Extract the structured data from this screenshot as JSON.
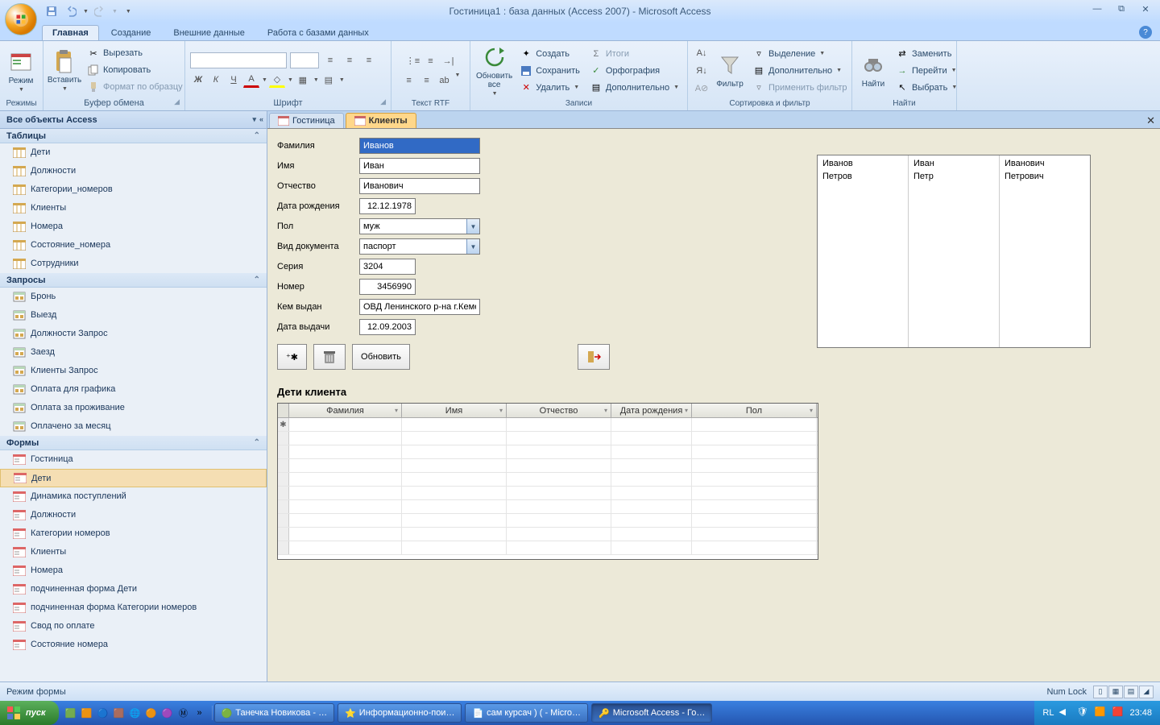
{
  "titlebar": {
    "title": "Гостиница1 : база данных (Access 2007) - Microsoft Access"
  },
  "tabs": {
    "main": "Главная",
    "create": "Создание",
    "extdata": "Внешние данные",
    "dbtools": "Работа с базами данных"
  },
  "ribbon": {
    "views": {
      "label": "Режимы",
      "view": "Режим"
    },
    "clipboard": {
      "label": "Буфер обмена",
      "paste": "Вставить",
      "cut": "Вырезать",
      "copy": "Копировать",
      "fmt": "Формат по образцу"
    },
    "font": {
      "label": "Шрифт"
    },
    "rtf": {
      "label": "Текст RTF"
    },
    "records": {
      "label": "Записи",
      "refresh": "Обновить\nвсе",
      "new": "Создать",
      "save": "Сохранить",
      "delete": "Удалить",
      "totals": "Итоги",
      "spelling": "Орфография",
      "more": "Дополнительно"
    },
    "sortfilter": {
      "label": "Сортировка и фильтр",
      "filter": "Фильтр",
      "selection": "Выделение",
      "advanced": "Дополнительно",
      "toggle": "Применить фильтр"
    },
    "find": {
      "label": "Найти",
      "find": "Найти",
      "replace": "Заменить",
      "goto": "Перейти",
      "select": "Выбрать"
    }
  },
  "nav": {
    "header": "Все объекты Access",
    "cat_tables": "Таблицы",
    "tables": [
      "Дети",
      "Должности",
      "Категории_номеров",
      "Клиенты",
      "Номера",
      "Состояние_номера",
      "Сотрудники"
    ],
    "cat_queries": "Запросы",
    "queries": [
      "Бронь",
      "Выезд",
      "Должности Запрос",
      "Заезд",
      "Клиенты Запрос",
      "Оплата для графика",
      "Оплата за проживание",
      "Оплачено за месяц"
    ],
    "cat_forms": "Формы",
    "forms": [
      "Гостиница",
      "Дети",
      "Динамика поступлений",
      "Должности",
      "Категории номеров",
      "Клиенты",
      "Номера",
      "подчиненная форма Дети",
      "подчиненная форма Категории номеров",
      "Свод по оплате",
      "Состояние номера"
    ]
  },
  "formtabs": {
    "t1": "Гостиница",
    "t2": "Клиенты"
  },
  "form": {
    "labels": {
      "surname": "Фамилия",
      "name": "Имя",
      "patr": "Отчество",
      "dob": "Дата рождения",
      "sex": "Пол",
      "doctype": "Вид документа",
      "series": "Серия",
      "number": "Номер",
      "issued": "Кем выдан",
      "issdate": "Дата выдачи"
    },
    "values": {
      "surname": "Иванов",
      "name": "Иван",
      "patr": "Иванович",
      "dob": "12.12.1978",
      "sex": "муж",
      "doctype": "паспорт",
      "series": "3204",
      "number": "3456990",
      "issued": "ОВД Ленинского р-на г.Кеме",
      "issdate": "12.09.2003"
    },
    "btn_refresh": "Обновить",
    "list": {
      "col1": [
        "Иванов",
        "Петров"
      ],
      "col2": [
        "Иван",
        "Петр"
      ],
      "col3": [
        "Иванович",
        "Петрович"
      ]
    },
    "subform": {
      "title": "Дети клиента",
      "cols": [
        "Фамилия",
        "Имя",
        "Отчество",
        "Дата рождения",
        "Пол"
      ]
    }
  },
  "statusbar": {
    "left": "Режим формы",
    "numlock": "Num Lock"
  },
  "taskbar": {
    "start": "пуск",
    "tasks": [
      "Танечка Новикова - …",
      "Информационно-пои…",
      "сам курсач ) ( - Micro…",
      "Microsoft Access - Го…"
    ],
    "lang": "RL",
    "time": "23:48"
  }
}
